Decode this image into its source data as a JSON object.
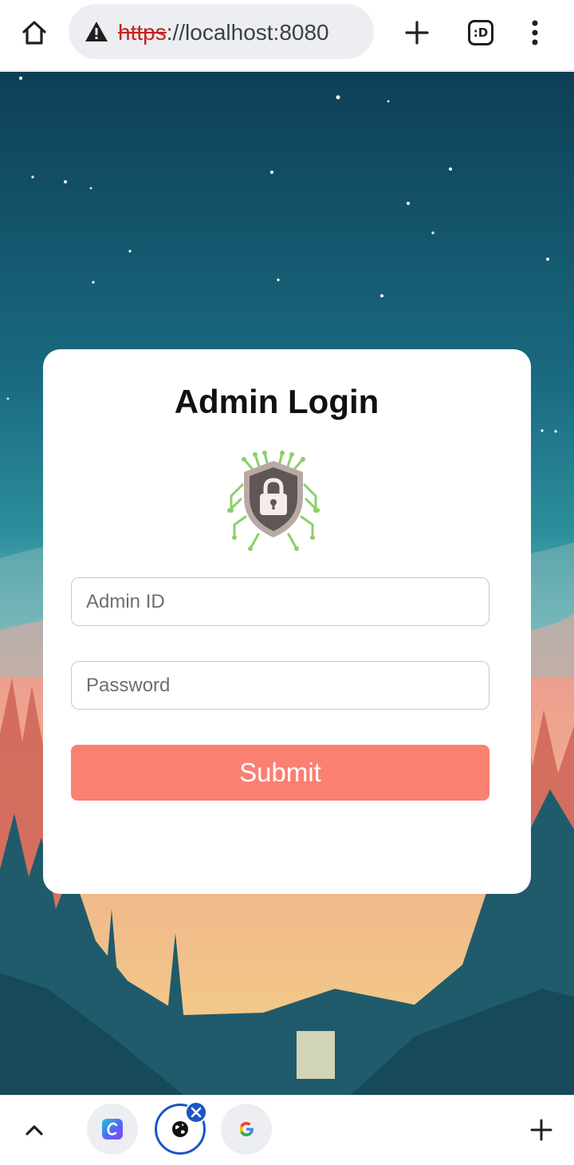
{
  "browser": {
    "url_scheme": "https",
    "url_rest": "://localhost:8080",
    "tab_count_label": ":D",
    "icons": {
      "home": "home-icon",
      "security_warning": "warning-icon",
      "new_tab": "plus-icon",
      "tab_switcher": "tab-switcher-icon",
      "menu": "more-vert-icon"
    }
  },
  "login": {
    "title": "Admin Login",
    "logo": "shield-lock-circuit-icon",
    "admin_id_placeholder": "Admin ID",
    "password_placeholder": "Password",
    "submit_label": "Submit"
  },
  "tab_strip": {
    "tabs": [
      {
        "icon": "canva-icon",
        "active": false
      },
      {
        "icon": "globe-icon",
        "active": true
      },
      {
        "icon": "google-icon",
        "active": false
      }
    ]
  },
  "colors": {
    "submit_button": "#fa8072",
    "active_tab_ring": "#1a56c4",
    "sky_top": "#0d3f57",
    "sky_horizon": "#2c8e9b",
    "sunset_glow": "#f6cf7b"
  }
}
